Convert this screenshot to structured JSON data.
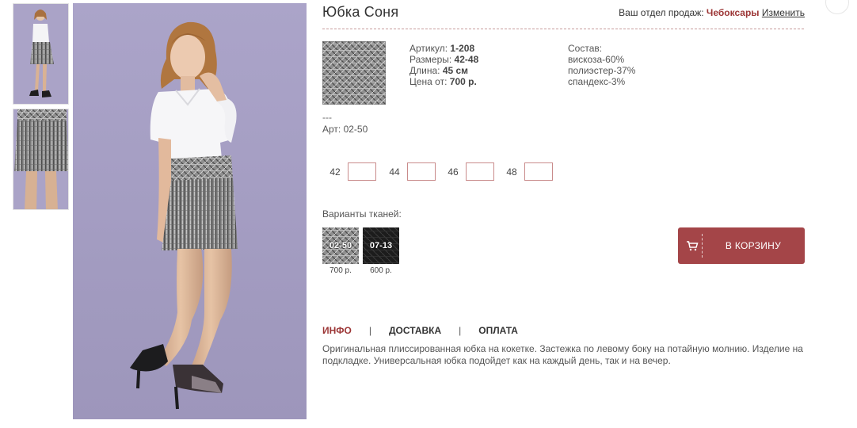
{
  "product": {
    "title": "Юбка Соня"
  },
  "region": {
    "label": "Ваш отдел продаж:",
    "city": "Чебоксары",
    "change": "Изменить"
  },
  "specs": {
    "article_label": "Артикул:",
    "article_value": "1-208",
    "sizes_label": "Размеры:",
    "sizes_value": "42-48",
    "length_label": "Длина:",
    "length_value": "45 см",
    "price_label": "Цена от:",
    "price_value": "700 р."
  },
  "composition": {
    "title": "Состав:",
    "items": [
      "вискоза-60%",
      "полиэстер-37%",
      "спандекс-3%"
    ]
  },
  "fabric_article": {
    "dash": "---",
    "code": "Арт: 02-50"
  },
  "sizes": [
    "42",
    "44",
    "46",
    "48"
  ],
  "fabrics": {
    "title": "Варианты тканей:",
    "items": [
      {
        "code": "02-50",
        "price": "700 р."
      },
      {
        "code": "07-13",
        "price": "600 р."
      }
    ]
  },
  "cart": {
    "label": "В КОРЗИНУ",
    "icon": "cart-icon"
  },
  "tabs": [
    "ИНФО",
    "ДОСТАВКА",
    "ОПЛАТА"
  ],
  "tab_separator": "|",
  "description": "Оригинальная плиссированная юбка на кокетке. Застежка по левому боку на потайную молнию. Изделие на подкладке. Универсальная юбка подойдет как на каждый день, так и на вечер.",
  "colors": {
    "accent": "#9c3636",
    "button": "#a44548",
    "photo_background": "#aaa3c7"
  }
}
